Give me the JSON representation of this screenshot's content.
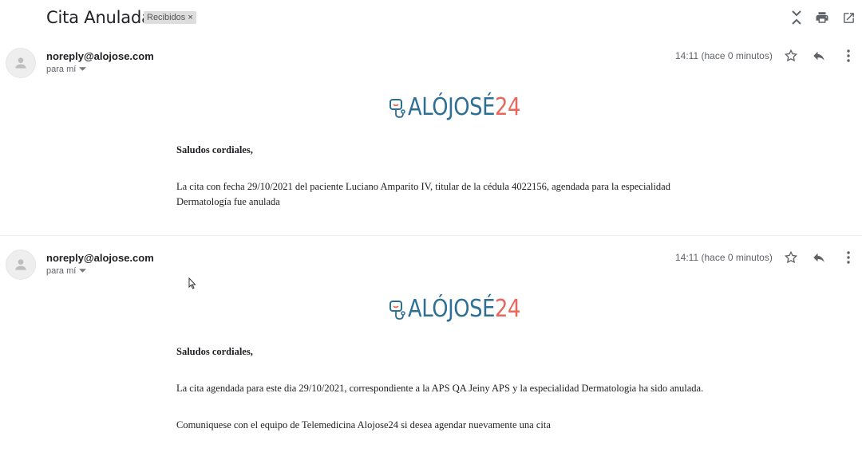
{
  "header": {
    "subject": "Cita Anulada",
    "label": "Recibidos",
    "label_close": "×",
    "icons": [
      "expand-collapse-icon",
      "print-icon",
      "open-new-window-icon"
    ]
  },
  "messages": [
    {
      "sender": "noreply@alojose.com",
      "to_label": "para mí",
      "time": "14:11 (hace 0 minutos)",
      "logo": {
        "text_blue": "ALÓJOSÉ",
        "text_red": "24",
        "color_blue": "#2e6f94",
        "color_red": "#e8665b"
      },
      "greeting": "Saludos cordiales,",
      "paragraphs": [
        "La cita con fecha 29/10/2021 del paciente Luciano Amparito IV, titular de la cédula 4022156, agendada para la especialidad",
        "Dermatología fue anulada"
      ]
    },
    {
      "sender": "noreply@alojose.com",
      "to_label": "para mí",
      "time": "14:11 (hace 0 minutos)",
      "logo": {
        "text_blue": "ALÓJOSÉ",
        "text_red": "24",
        "color_blue": "#2e6f94",
        "color_red": "#e8665b"
      },
      "greeting": "Saludos cordiales,",
      "paragraphs": [
        "La cita agendada para este dia 29/10/2021, correspondiente a la APS QA Jeiny APS y la especialidad Dermatologia ha sido anulada.",
        "Comuniquese con el equipo de Telemedicina Alojose24 si desea agendar nuevamente una cita"
      ]
    }
  ],
  "colors": {
    "icon": "#5f6368",
    "divider": "#eceff1",
    "label_bg": "#dddddd"
  }
}
